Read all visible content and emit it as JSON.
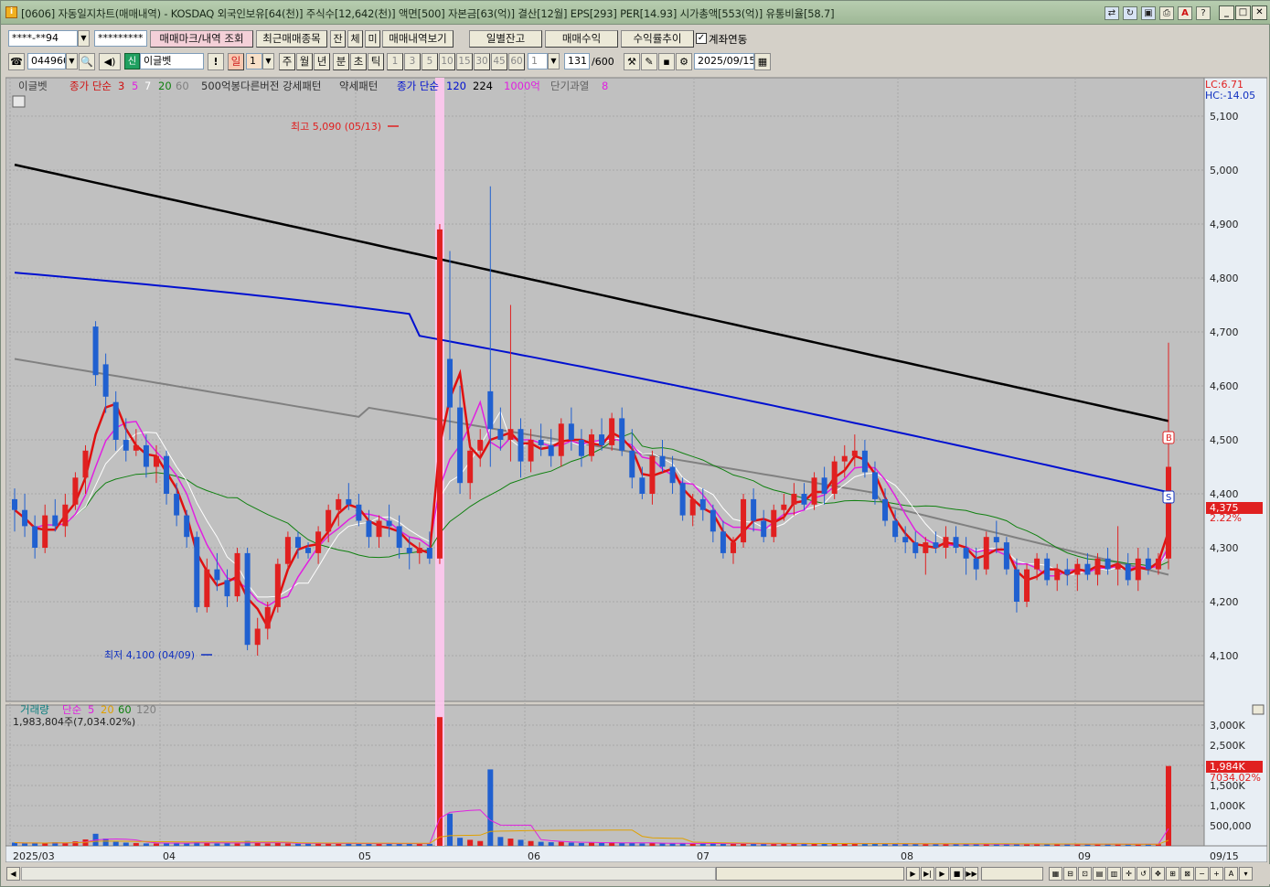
{
  "window": {
    "title": "[0606] 자동일지차트(매매내역) - KOSDAQ 외국인보유[64(천)] 주식수[12,642(천)] 액면[500] 자본금[63(억)] 결산[12월] EPS[293] PER[14.93] 시가총액[553(억)] 유통비율[58.7]"
  },
  "toolbar1": {
    "account": "****-**94",
    "password": "*********",
    "btn_trade_mark": "매매마크/내역 조회",
    "btn_recent": "최근매매종목",
    "btn_jan": "잔",
    "btn_che": "체",
    "btn_mi": "미",
    "btn_trade_view": "매매내역보기",
    "btn_daily_balance": "일별잔고",
    "btn_trade_profit": "매매수익",
    "btn_return_trend": "수익률추이",
    "chk_account_link": "계좌연동"
  },
  "toolbar2": {
    "code": "044960",
    "name_badge": "신",
    "name": "이글벳",
    "exclaim": "!",
    "period_il": "일",
    "period_num": "1",
    "periods": [
      "주",
      "월",
      "년",
      "분",
      "초",
      "틱"
    ],
    "numbers": [
      "1",
      "3",
      "5",
      "10",
      "15",
      "30",
      "45",
      "60"
    ],
    "num_select": "1",
    "count": "131",
    "count_total": "/600",
    "date": "2025/09/15"
  },
  "legend": {
    "name": "이글벳",
    "ma_label": "종가 단순",
    "ma3": "3",
    "ma5": "5",
    "ma7": "7",
    "ma20": "20",
    "ma60": "60",
    "pattern1": "500억봉다른버전 강세패턴",
    "pattern2": "약세패턴",
    "ma_label2": "종가 단순",
    "ma120": "120",
    "ma224": "224",
    "ma1000": "1000억",
    "short_over": "단기과열",
    "short_over_n": "8"
  },
  "vol_legend": {
    "label": "거래량",
    "ma_label": "단순",
    "v5": "5",
    "v20": "20",
    "v60": "60",
    "v120": "120",
    "current": "1,983,804주(7,034.02%)"
  },
  "annotations": {
    "high": "최고 5,090 (05/13)",
    "low": "최저 4,100 (04/09)",
    "lc": "LC:6.71",
    "hc": "HC:-14.05",
    "last_price": "4,375",
    "last_pct": "2.22%",
    "last_vol": "1,984K",
    "last_vol_pct": "7034.02%",
    "mark_b": "B",
    "mark_s": "S"
  },
  "price_axis": [
    "5,100",
    "5,000",
    "4,900",
    "4,800",
    "4,700",
    "4,600",
    "4,500",
    "4,400",
    "4,300",
    "4,200",
    "4,100"
  ],
  "vol_axis": [
    "3,000K",
    "2,500K",
    "2,000K",
    "1,500K",
    "1,000K",
    "500,000"
  ],
  "date_axis": [
    "2025/03",
    "04",
    "05",
    "06",
    "07",
    "08",
    "09",
    "09/15"
  ],
  "colors": {
    "up": "#e02020",
    "down": "#2060d0",
    "ma224": "#000000",
    "ma120": "#0010d0",
    "ma60": "#808080",
    "ma20": "#108010",
    "ma5": "#e020e0",
    "ma3": "#e01010",
    "chart_bg": "#c0c0c0"
  },
  "chart_data": {
    "type": "candlestick",
    "ylim": [
      4060,
      5160
    ],
    "vol_ylim": [
      0,
      3300000
    ],
    "candles": [
      [
        4390,
        4410,
        4330,
        4370
      ],
      [
        4370,
        4400,
        4320,
        4340
      ],
      [
        4340,
        4360,
        4280,
        4300
      ],
      [
        4300,
        4380,
        4290,
        4360
      ],
      [
        4360,
        4390,
        4330,
        4340
      ],
      [
        4340,
        4400,
        4320,
        4380
      ],
      [
        4380,
        4440,
        4370,
        4430
      ],
      [
        4430,
        4490,
        4400,
        4480
      ],
      [
        4710,
        4720,
        4600,
        4620
      ],
      [
        4640,
        4660,
        4550,
        4580
      ],
      [
        4570,
        4590,
        4480,
        4500
      ],
      [
        4500,
        4540,
        4460,
        4480
      ],
      [
        4480,
        4520,
        4470,
        4490
      ],
      [
        4490,
        4510,
        4430,
        4450
      ],
      [
        4450,
        4490,
        4420,
        4470
      ],
      [
        4470,
        4480,
        4380,
        4400
      ],
      [
        4400,
        4420,
        4340,
        4360
      ],
      [
        4360,
        4370,
        4300,
        4320
      ],
      [
        4320,
        4330,
        4180,
        4190
      ],
      [
        4190,
        4280,
        4180,
        4260
      ],
      [
        4260,
        4290,
        4220,
        4240
      ],
      [
        4240,
        4260,
        4190,
        4210
      ],
      [
        4210,
        4300,
        4200,
        4290
      ],
      [
        4290,
        4300,
        4110,
        4120
      ],
      [
        4120,
        4170,
        4100,
        4150
      ],
      [
        4150,
        4200,
        4130,
        4190
      ],
      [
        4190,
        4280,
        4180,
        4270
      ],
      [
        4270,
        4330,
        4260,
        4320
      ],
      [
        4320,
        4330,
        4280,
        4300
      ],
      [
        4300,
        4310,
        4280,
        4290
      ],
      [
        4290,
        4340,
        4270,
        4330
      ],
      [
        4330,
        4380,
        4310,
        4370
      ],
      [
        4370,
        4400,
        4340,
        4390
      ],
      [
        4390,
        4420,
        4370,
        4380
      ],
      [
        4380,
        4400,
        4340,
        4350
      ],
      [
        4350,
        4370,
        4300,
        4320
      ],
      [
        4320,
        4360,
        4300,
        4350
      ],
      [
        4350,
        4380,
        4320,
        4340
      ],
      [
        4340,
        4360,
        4280,
        4300
      ],
      [
        4300,
        4320,
        4260,
        4290
      ],
      [
        4290,
        4310,
        4270,
        4300
      ],
      [
        4300,
        4330,
        4270,
        4280
      ],
      [
        4280,
        4900,
        4270,
        4890
      ],
      [
        4650,
        4850,
        4500,
        4560
      ],
      [
        4560,
        4600,
        4400,
        4420
      ],
      [
        4420,
        4500,
        4390,
        4480
      ],
      [
        4480,
        4520,
        4450,
        4500
      ],
      [
        4590,
        4970,
        4450,
        4520
      ],
      [
        4520,
        4560,
        4480,
        4500
      ],
      [
        4500,
        4750,
        4460,
        4520
      ],
      [
        4520,
        4540,
        4430,
        4460
      ],
      [
        4460,
        4520,
        4440,
        4500
      ],
      [
        4500,
        4530,
        4470,
        4490
      ],
      [
        4490,
        4520,
        4450,
        4470
      ],
      [
        4470,
        4540,
        4450,
        4530
      ],
      [
        4530,
        4560,
        4480,
        4500
      ],
      [
        4500,
        4520,
        4450,
        4470
      ],
      [
        4470,
        4520,
        4460,
        4510
      ],
      [
        4510,
        4540,
        4480,
        4490
      ],
      [
        4490,
        4550,
        4480,
        4540
      ],
      [
        4540,
        4560,
        4470,
        4480
      ],
      [
        4480,
        4520,
        4410,
        4430
      ],
      [
        4430,
        4450,
        4390,
        4400
      ],
      [
        4400,
        4480,
        4380,
        4470
      ],
      [
        4470,
        4500,
        4440,
        4450
      ],
      [
        4450,
        4470,
        4400,
        4420
      ],
      [
        4420,
        4430,
        4350,
        4360
      ],
      [
        4360,
        4400,
        4340,
        4390
      ],
      [
        4390,
        4410,
        4350,
        4370
      ],
      [
        4370,
        4380,
        4310,
        4330
      ],
      [
        4330,
        4350,
        4280,
        4290
      ],
      [
        4290,
        4320,
        4270,
        4310
      ],
      [
        4310,
        4400,
        4300,
        4390
      ],
      [
        4390,
        4410,
        4330,
        4350
      ],
      [
        4350,
        4370,
        4310,
        4320
      ],
      [
        4320,
        4380,
        4310,
        4370
      ],
      [
        4370,
        4400,
        4350,
        4380
      ],
      [
        4380,
        4420,
        4360,
        4400
      ],
      [
        4400,
        4420,
        4370,
        4380
      ],
      [
        4380,
        4440,
        4370,
        4430
      ],
      [
        4430,
        4450,
        4380,
        4400
      ],
      [
        4400,
        4470,
        4390,
        4460
      ],
      [
        4460,
        4490,
        4430,
        4470
      ],
      [
        4470,
        4510,
        4450,
        4480
      ],
      [
        4480,
        4500,
        4430,
        4440
      ],
      [
        4440,
        4460,
        4380,
        4390
      ],
      [
        4390,
        4410,
        4340,
        4350
      ],
      [
        4350,
        4370,
        4310,
        4320
      ],
      [
        4320,
        4340,
        4290,
        4310
      ],
      [
        4310,
        4330,
        4280,
        4290
      ],
      [
        4290,
        4320,
        4250,
        4310
      ],
      [
        4310,
        4330,
        4290,
        4300
      ],
      [
        4300,
        4340,
        4280,
        4320
      ],
      [
        4320,
        4340,
        4290,
        4300
      ],
      [
        4300,
        4320,
        4250,
        4280
      ],
      [
        4280,
        4300,
        4240,
        4260
      ],
      [
        4260,
        4330,
        4250,
        4320
      ],
      [
        4320,
        4350,
        4290,
        4310
      ],
      [
        4310,
        4320,
        4250,
        4260
      ],
      [
        4260,
        4280,
        4180,
        4200
      ],
      [
        4200,
        4270,
        4190,
        4260
      ],
      [
        4260,
        4290,
        4240,
        4280
      ],
      [
        4280,
        4290,
        4230,
        4240
      ],
      [
        4240,
        4270,
        4220,
        4260
      ],
      [
        4260,
        4280,
        4230,
        4250
      ],
      [
        4250,
        4280,
        4220,
        4270
      ],
      [
        4270,
        4290,
        4240,
        4250
      ],
      [
        4250,
        4290,
        4230,
        4280
      ],
      [
        4280,
        4300,
        4250,
        4260
      ],
      [
        4260,
        4340,
        4230,
        4270
      ],
      [
        4270,
        4290,
        4230,
        4240
      ],
      [
        4240,
        4300,
        4220,
        4280
      ],
      [
        4280,
        4300,
        4250,
        4260
      ],
      [
        4260,
        4290,
        4250,
        4280
      ],
      [
        4280,
        4680,
        4260,
        4450
      ]
    ],
    "volume": [
      80,
      60,
      70,
      60,
      90,
      70,
      110,
      160,
      300,
      180,
      100,
      80,
      70,
      60,
      60,
      70,
      80,
      60,
      90,
      70,
      60,
      70,
      60,
      120,
      80,
      60,
      70,
      60,
      50,
      60,
      60,
      60,
      50,
      60,
      50,
      60,
      50,
      60,
      50,
      60,
      50,
      50,
      3200,
      800,
      200,
      150,
      120,
      1900,
      220,
      180,
      150,
      120,
      100,
      90,
      100,
      80,
      70,
      80,
      70,
      90,
      70,
      70,
      60,
      70,
      60,
      60,
      60,
      50,
      60,
      60,
      50,
      50,
      60,
      50,
      50,
      50,
      60,
      50,
      50,
      60,
      50,
      60,
      60,
      60,
      50,
      50,
      50,
      50,
      50,
      50,
      50,
      40,
      50,
      40,
      40,
      50,
      40,
      40,
      40,
      50,
      50,
      40,
      40,
      40,
      40,
      40,
      40,
      40,
      40,
      40,
      40,
      40,
      40,
      40,
      1984
    ]
  }
}
